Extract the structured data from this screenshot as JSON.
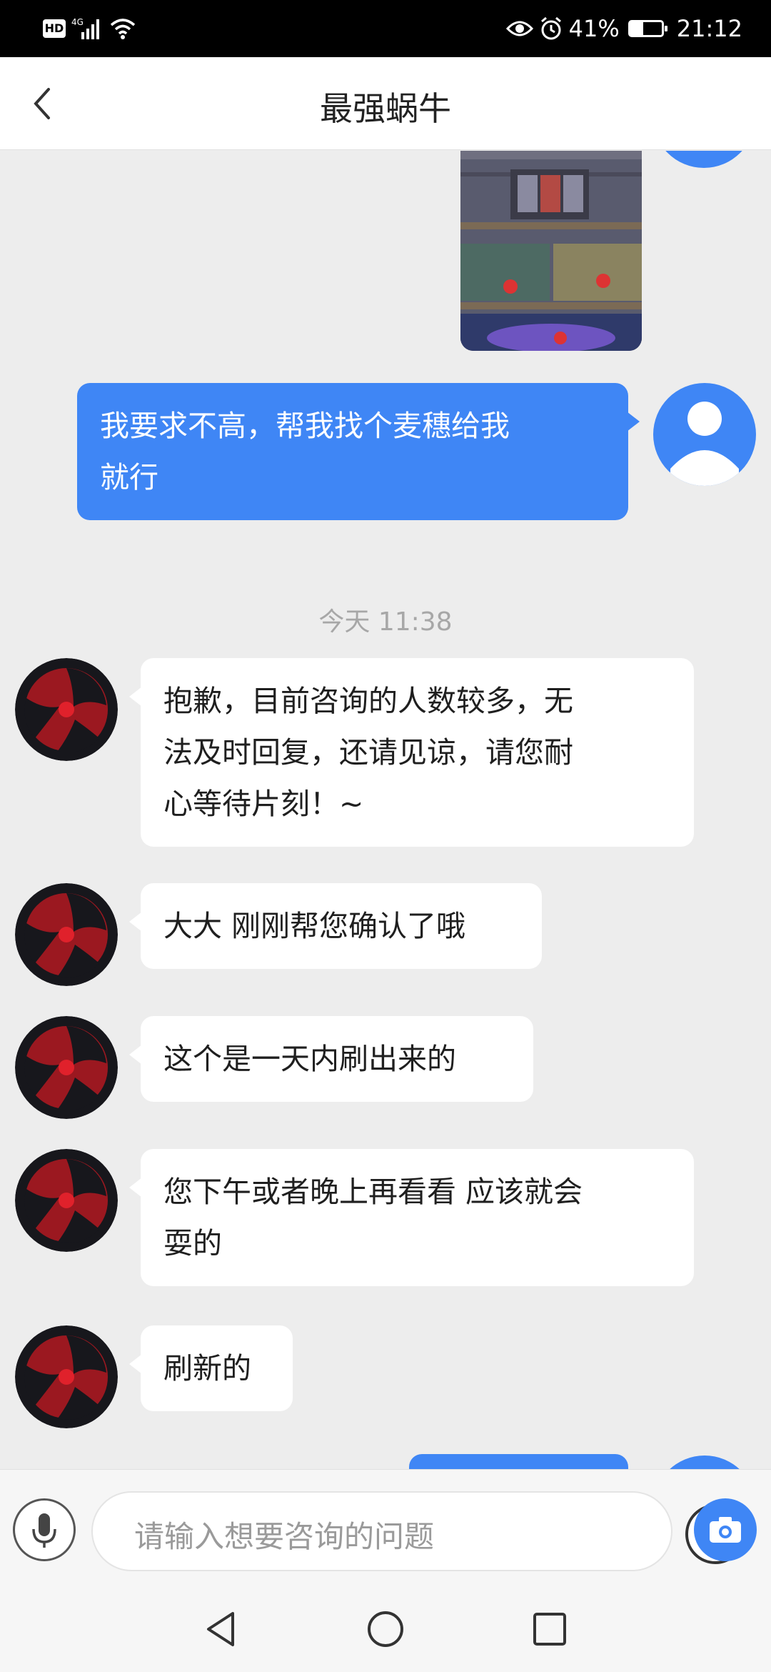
{
  "status_bar": {
    "hd": "HD",
    "network": "4G",
    "battery_percent": "41%",
    "battery_level": 0.41,
    "time": "21:12",
    "icons": [
      "hd-icon",
      "signal-icon",
      "wifi-icon",
      "eye-icon",
      "alarm-icon",
      "battery-icon"
    ]
  },
  "header": {
    "title": "最强蜗牛",
    "back_icon": "chevron-left-icon"
  },
  "chat": {
    "shared_image_alt": "game screenshot",
    "messages": [
      {
        "from": "user",
        "lines": [
          "我要求不高，帮我找个麦穗给我",
          "就行"
        ]
      },
      {
        "type": "timestamp",
        "text": "今天 11:38"
      },
      {
        "from": "agent",
        "lines": [
          "抱歉，目前咨询的人数较多，无",
          "法及时回复，还请见谅，请您耐",
          "心等待片刻！~"
        ]
      },
      {
        "from": "agent",
        "lines": [
          "大大 刚刚帮您确认了哦"
        ]
      },
      {
        "from": "agent",
        "lines": [
          "这个是一天内刷出来的"
        ]
      },
      {
        "from": "agent",
        "lines": [
          "您下午或者晚上再看看 应该就会",
          "耍的"
        ]
      },
      {
        "from": "agent",
        "lines": [
          "刷新的"
        ]
      }
    ]
  },
  "input": {
    "placeholder": "请输入想要咨询的问题",
    "icons": [
      "microphone-icon",
      "emoji-icon",
      "camera-icon"
    ]
  },
  "nav": {
    "icons": [
      "back-triangle-icon",
      "home-circle-icon",
      "recent-square-icon"
    ]
  },
  "colors": {
    "accent": "#3f86f5",
    "background": "#ededed",
    "bubble_in": "#ffffff",
    "agent_avatar_red": "#e0212b"
  }
}
